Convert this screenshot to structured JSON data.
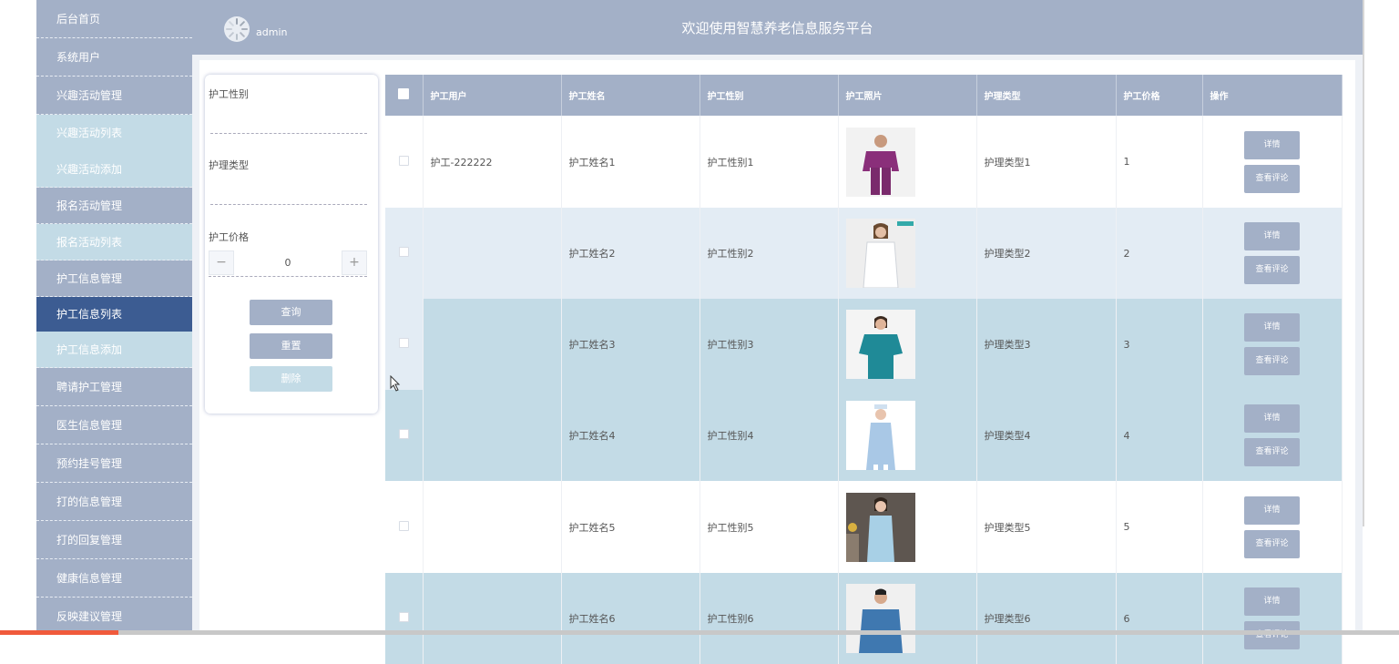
{
  "app": {
    "title": "欢迎使用智慧养老信息服务平台",
    "username": "admin"
  },
  "sidebar": {
    "items": [
      {
        "label": "后台首页"
      },
      {
        "label": "系统用户"
      },
      {
        "label": "兴趣活动管理"
      },
      {
        "label": "兴趣活动列表"
      },
      {
        "label": "兴趣活动添加"
      },
      {
        "label": "报名活动管理"
      },
      {
        "label": "报名活动列表"
      },
      {
        "label": "护工信息管理"
      },
      {
        "label": "护工信息列表"
      },
      {
        "label": "护工信息添加"
      },
      {
        "label": "聘请护工管理"
      },
      {
        "label": "医生信息管理"
      },
      {
        "label": "预约挂号管理"
      },
      {
        "label": "打的信息管理"
      },
      {
        "label": "打的回复管理"
      },
      {
        "label": "健康信息管理"
      },
      {
        "label": "反映建议管理"
      }
    ],
    "active": "护工信息列表"
  },
  "filter": {
    "gender_label": "护工性别",
    "type_label": "护理类型",
    "price_label": "护工价格",
    "price_value": "0",
    "minus": "−",
    "plus": "+",
    "search_button": "查询",
    "reset_button": "重置",
    "delete_button": "删除"
  },
  "table": {
    "columns": [
      "护工用户",
      "护工姓名",
      "护工性别",
      "护工照片",
      "护理类型",
      "护工价格",
      "操作"
    ],
    "detail_button": "详情",
    "review_button": "查看评论",
    "rows": [
      {
        "user": "护工-222222",
        "name": "护工姓名1",
        "gender": "护工性别1",
        "photo": "purple-scrubs-worker",
        "type": "护理类型1",
        "price": "1"
      },
      {
        "user": "",
        "name": "护工姓名2",
        "gender": "护工性别2",
        "photo": "white-coat-worker",
        "type": "护理类型2",
        "price": "2"
      },
      {
        "user": "",
        "name": "护工姓名3",
        "gender": "护工性别3",
        "photo": "teal-scrubs-worker",
        "type": "护理类型3",
        "price": "3"
      },
      {
        "user": "",
        "name": "护工姓名4",
        "gender": "护工性别4",
        "photo": "light-blue-nurse",
        "type": "护理类型4",
        "price": "4"
      },
      {
        "user": "",
        "name": "护工姓名5",
        "gender": "护工性别5",
        "photo": "blue-uniform-worker",
        "type": "护理类型5",
        "price": "5"
      },
      {
        "user": "",
        "name": "护工姓名6",
        "gender": "护工性别6",
        "photo": "blue-shirt-worker",
        "type": "护理类型6",
        "price": "6"
      }
    ]
  },
  "colors": {
    "primary": "#a3b0c7",
    "active": "#3c5c92",
    "row_alt": "#c3dbe6",
    "row_light": "#e3ecf4"
  }
}
